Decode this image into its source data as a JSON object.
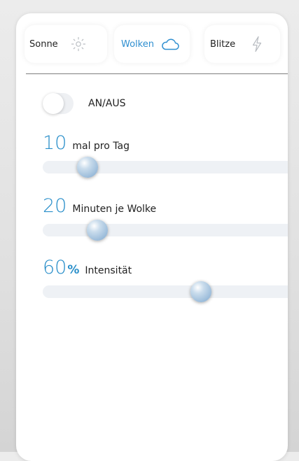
{
  "tabs": [
    {
      "label": "Sonne",
      "icon": "sun-icon",
      "active": false
    },
    {
      "label": "Wolken",
      "icon": "cloud-icon",
      "active": true
    },
    {
      "label": "Blitze",
      "icon": "lightning-icon",
      "active": false
    }
  ],
  "toggle": {
    "label": "AN/AUS",
    "on": false
  },
  "sliders": [
    {
      "value": "10",
      "unit": "",
      "label": "mal pro Tag",
      "fraction": 0.15
    },
    {
      "value": "20",
      "unit": "",
      "label": "Minuten je Wolke",
      "fraction": 0.19
    },
    {
      "value": "60",
      "unit": "%",
      "label": "Intensität",
      "fraction": 0.6
    }
  ],
  "colors": {
    "accent": "#2a8fca",
    "active_tab": "#2f8fd0",
    "track": "#eef1f5"
  }
}
